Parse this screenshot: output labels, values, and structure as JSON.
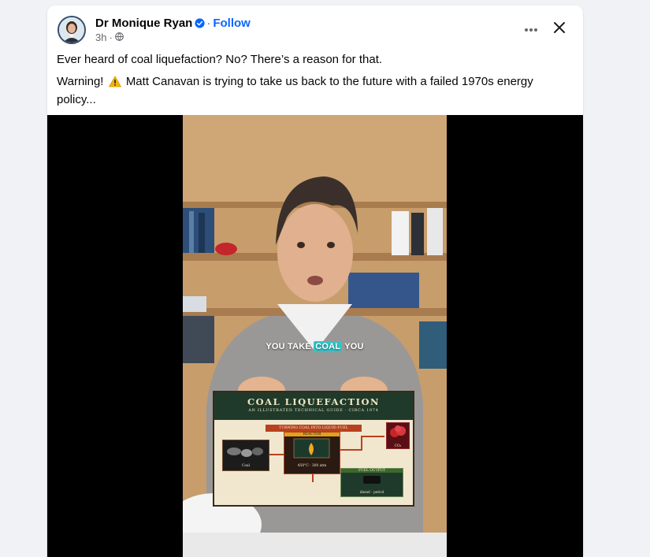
{
  "post": {
    "author": "Dr Monique Ryan",
    "follow_label": "Follow",
    "separator": "·",
    "time": "3h",
    "paragraphs": [
      "Ever heard of coal liquefaction? No? There’s a reason for that.",
      "Matt Canavan is trying to take us back to the future with a failed 1970s energy policy..."
    ],
    "warning_prefix": "Warning!",
    "icons": {
      "verified": "verified-badge-icon",
      "globe": "globe-icon",
      "more": "more-options-icon",
      "close": "close-icon",
      "warning": "warning-icon"
    }
  },
  "video": {
    "caption_before": "YOU TAKE ",
    "caption_highlight": "COAL",
    "caption_after": " YOU",
    "infographic": {
      "title": "COAL LIQUEFACTION",
      "subtitle": "AN ILLUSTRATED TECHNICAL GUIDE · CIRCA 1974",
      "banner": "TURNING COAL INTO LIQUID FUEL",
      "coal_label": "Coal",
      "reactor_label": "REACTOR",
      "reactor_temp": "450°C · 300 atm",
      "emissions_label": "CO₂",
      "fuel_label": "FUEL OUTPUT",
      "fuel_sub": "diesel · petrol"
    }
  },
  "colors": {
    "link": "#0866ff",
    "highlight": "#33c4c8",
    "infographic_header": "#1f3a2a",
    "infographic_banner": "#b8421f"
  }
}
